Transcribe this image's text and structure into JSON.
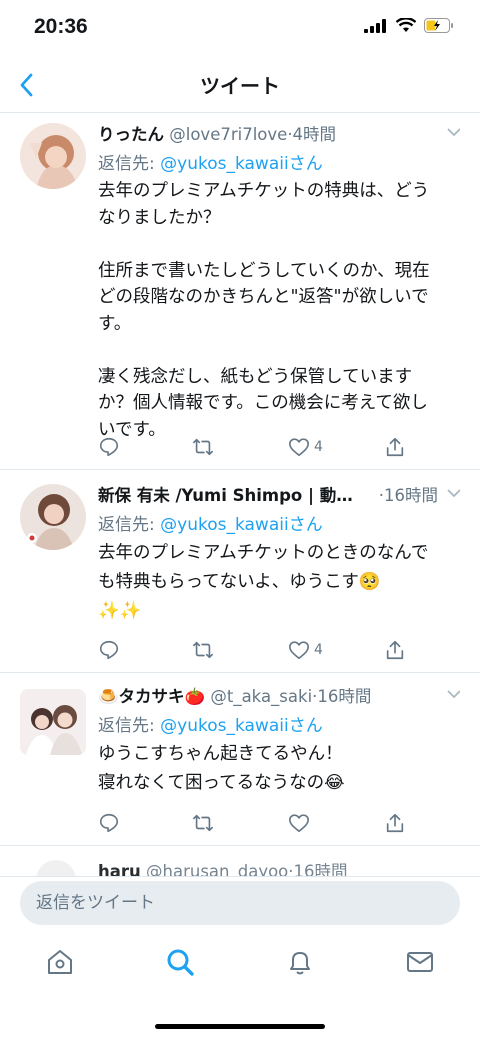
{
  "status_bar": {
    "time": "20:36"
  },
  "header": {
    "title": "ツイート"
  },
  "tweets": [
    {
      "name": "りったん",
      "handle": "@love7ri7love",
      "time": "·4時間",
      "reply_prefix": "返信先: ",
      "reply_to": "@yukos_kawaiiさん",
      "text": "去年のプレミアムチケットの特典は、どう\nなりましたか？\n\n住所まで書いたしどうしていくのか、現在\nどの段階なのかきちんと\"返答\"が欲しいで\nす。\n\n凄く残念だし、紙もどう保管しています\nか？個人情報です。この機会に考えて欲し\nいです。",
      "likes": "4"
    },
    {
      "name": "新保 有未 /Yumi Shimpo | 動…",
      "handle": "",
      "time": "·16時間",
      "reply_prefix": "返信先: ",
      "reply_to": "@yukos_kawaiiさん",
      "text": "去年のプレミアムチケットのときのなんで\nも特典もらってないよ、ゆうこす🥺\n✨✨",
      "likes": "4"
    },
    {
      "name": "🍮タカサキ🍅",
      "handle": "@t_aka_saki",
      "time": "·16時間",
      "reply_prefix": "返信先: ",
      "reply_to": "@yukos_kawaiiさん",
      "text": "ゆうこすちゃん起きてるやん！\n寝れなくて困ってるなうなの😂",
      "likes": ""
    }
  ],
  "peek_tweet": {
    "name": "haru",
    "handle": "@harusan_dayoo",
    "time": "·16時間"
  },
  "composer": {
    "placeholder": "返信をツイート"
  },
  "tabbar": [
    "home-icon",
    "search-icon",
    "notifications-icon",
    "messages-icon"
  ],
  "colors": {
    "accent": "#1da1f2",
    "muted": "#657786",
    "text": "#14171a",
    "divider": "#e1e8ed"
  }
}
